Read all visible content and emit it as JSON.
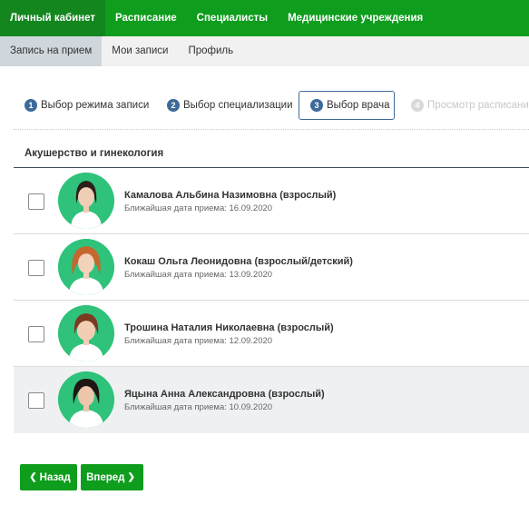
{
  "topnav": {
    "items": [
      {
        "label": "Личный кабинет",
        "active": true
      },
      {
        "label": "Расписание",
        "active": false
      },
      {
        "label": "Специалисты",
        "active": false
      },
      {
        "label": "Медицинские учреждения",
        "active": false
      }
    ]
  },
  "subnav": {
    "items": [
      {
        "label": "Запись на прием",
        "active": true
      },
      {
        "label": "Мои записи",
        "active": false
      },
      {
        "label": "Профиль",
        "active": false
      }
    ]
  },
  "steps": [
    {
      "num": "1",
      "label": "Выбор режима записи",
      "state": "done"
    },
    {
      "num": "2",
      "label": "Выбор специализации",
      "state": "done"
    },
    {
      "num": "3",
      "label": "Выбор врача",
      "state": "current"
    },
    {
      "num": "4",
      "label": "Просмотр расписания",
      "state": "disabled"
    }
  ],
  "section": {
    "title": "Акушерство и гинекология"
  },
  "doctors": [
    {
      "name": "Камалова Альбина Назимовна (взрослый)",
      "date_label": "Ближайшая дата приема: 16.09.2020",
      "checked": false
    },
    {
      "name": "Кокаш Ольга Леонидовна (взрослый/детский)",
      "date_label": "Ближайшая дата приема: 13.09.2020",
      "checked": false
    },
    {
      "name": "Трошина Наталия Николаевна (взрослый)",
      "date_label": "Ближайшая дата приема: 12.09.2020",
      "checked": false
    },
    {
      "name": "Яцына Анна Александровна (взрослый)",
      "date_label": "Ближайшая дата приема: 10.09.2020",
      "checked": false
    }
  ],
  "buttons": {
    "back": "Назад",
    "next": "Вперед"
  },
  "icons": {
    "back": "chevron-left-icon",
    "next": "chevron-right-icon"
  },
  "colors": {
    "brand_green": "#0e9d1d",
    "step_blue": "#3d6b99",
    "avatar_bg": "#2fc27a"
  }
}
